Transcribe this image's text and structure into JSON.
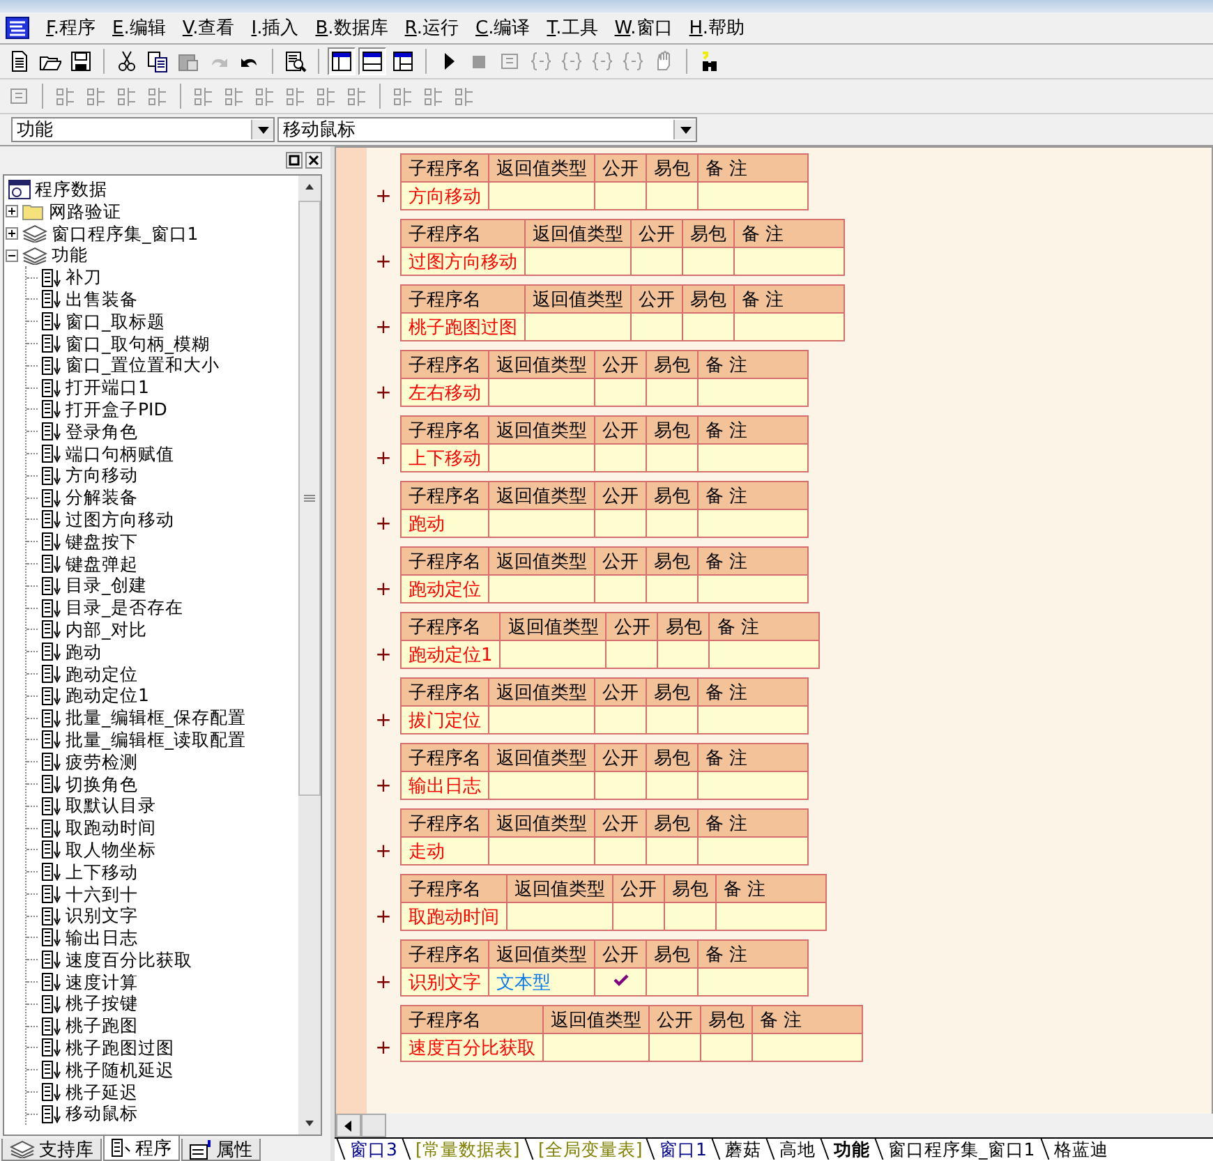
{
  "menu": [
    {
      "key": "F",
      "label": ".程序"
    },
    {
      "key": "E",
      "label": ".编辑"
    },
    {
      "key": "V",
      "label": ".查看"
    },
    {
      "key": "I",
      "label": ".插入"
    },
    {
      "key": "B",
      "label": ".数据库"
    },
    {
      "key": "R",
      "label": ".运行"
    },
    {
      "key": "C",
      "label": ".编译"
    },
    {
      "key": "T",
      "label": ".工具"
    },
    {
      "key": "W",
      "label": ".窗口"
    },
    {
      "key": "H",
      "label": ".帮助"
    }
  ],
  "layout_toggles": [
    {
      "pressed": true
    },
    {
      "pressed": true
    },
    {
      "pressed": false
    }
  ],
  "selectors": [
    {
      "value": "功能"
    },
    {
      "value": "移动鼠标"
    }
  ],
  "tree": {
    "label": "程序数据",
    "children": [
      {
        "label": "网路验证",
        "kind": "folder",
        "expanded": false
      },
      {
        "label": "窗口程序集_窗口1",
        "kind": "module",
        "expanded": false
      },
      {
        "label": "功能",
        "kind": "module",
        "expanded": true,
        "children": [
          {
            "label": "补刀",
            "kind": "sub"
          },
          {
            "label": "出售装备",
            "kind": "sub"
          },
          {
            "label": "窗口_取标题",
            "kind": "sub"
          },
          {
            "label": "窗口_取句柄_模糊",
            "kind": "sub"
          },
          {
            "label": "窗口_置位置和大小",
            "kind": "sub"
          },
          {
            "label": "打开端口1",
            "kind": "sub"
          },
          {
            "label": "打开盒子PID",
            "kind": "sub"
          },
          {
            "label": "登录角色",
            "kind": "sub"
          },
          {
            "label": "端口句柄赋值",
            "kind": "sub"
          },
          {
            "label": "方向移动",
            "kind": "sub"
          },
          {
            "label": "分解装备",
            "kind": "sub"
          },
          {
            "label": "过图方向移动",
            "kind": "sub"
          },
          {
            "label": "键盘按下",
            "kind": "sub"
          },
          {
            "label": "键盘弹起",
            "kind": "sub"
          },
          {
            "label": "目录_创建",
            "kind": "sub"
          },
          {
            "label": "目录_是否存在",
            "kind": "sub"
          },
          {
            "label": "内部_对比",
            "kind": "sub"
          },
          {
            "label": "跑动",
            "kind": "sub"
          },
          {
            "label": "跑动定位",
            "kind": "sub"
          },
          {
            "label": "跑动定位1",
            "kind": "sub"
          },
          {
            "label": "批量_编辑框_保存配置",
            "kind": "sub"
          },
          {
            "label": "批量_编辑框_读取配置",
            "kind": "sub"
          },
          {
            "label": "疲劳检测",
            "kind": "sub"
          },
          {
            "label": "切换角色",
            "kind": "sub"
          },
          {
            "label": "取默认目录",
            "kind": "sub"
          },
          {
            "label": "取跑动时间",
            "kind": "sub"
          },
          {
            "label": "取人物坐标",
            "kind": "sub"
          },
          {
            "label": "上下移动",
            "kind": "sub"
          },
          {
            "label": "十六到十",
            "kind": "sub"
          },
          {
            "label": "识别文字",
            "kind": "sub"
          },
          {
            "label": "输出日志",
            "kind": "sub"
          },
          {
            "label": "速度百分比获取",
            "kind": "sub"
          },
          {
            "label": "速度计算",
            "kind": "sub"
          },
          {
            "label": "桃子按键",
            "kind": "sub"
          },
          {
            "label": "桃子跑图",
            "kind": "sub"
          },
          {
            "label": "桃子跑图过图",
            "kind": "sub"
          },
          {
            "label": "桃子随机延迟",
            "kind": "sub"
          },
          {
            "label": "桃子延迟",
            "kind": "sub"
          },
          {
            "label": "移动鼠标",
            "kind": "sub"
          }
        ]
      }
    ]
  },
  "panel_tabs": [
    {
      "label": "支持库",
      "kind": "library",
      "selected": false
    },
    {
      "label": "程序",
      "kind": "program",
      "selected": true
    },
    {
      "label": "属性",
      "kind": "property",
      "selected": false
    }
  ],
  "subroutines": [
    {
      "expander": "+",
      "columns": [
        "子程序名",
        "返回值类型",
        "公开",
        "易包",
        "备 注"
      ],
      "name": "方向移动",
      "public": false
    },
    {
      "expander": "+",
      "columns": [
        "子程序名",
        "返回值类型",
        "公开",
        "易包",
        "备 注"
      ],
      "name": "过图方向移动",
      "public": false
    },
    {
      "expander": "+",
      "columns": [
        "子程序名",
        "返回值类型",
        "公开",
        "易包",
        "备 注"
      ],
      "name": "桃子跑图过图",
      "public": false
    },
    {
      "expander": "+",
      "columns": [
        "子程序名",
        "返回值类型",
        "公开",
        "易包",
        "备 注"
      ],
      "name": "左右移动",
      "public": false
    },
    {
      "expander": "+",
      "columns": [
        "子程序名",
        "返回值类型",
        "公开",
        "易包",
        "备 注"
      ],
      "name": "上下移动",
      "public": false
    },
    {
      "expander": "+",
      "columns": [
        "子程序名",
        "返回值类型",
        "公开",
        "易包",
        "备 注"
      ],
      "name": "跑动",
      "public": false
    },
    {
      "expander": "+",
      "columns": [
        "子程序名",
        "返回值类型",
        "公开",
        "易包",
        "备 注"
      ],
      "name": "跑动定位",
      "public": false
    },
    {
      "expander": "+",
      "columns": [
        "子程序名",
        "返回值类型",
        "公开",
        "易包",
        "备 注"
      ],
      "name": "跑动定位1",
      "public": false
    },
    {
      "expander": "+",
      "columns": [
        "子程序名",
        "返回值类型",
        "公开",
        "易包",
        "备 注"
      ],
      "name": "拔门定位",
      "public": false
    },
    {
      "expander": "+",
      "columns": [
        "子程序名",
        "返回值类型",
        "公开",
        "易包",
        "备 注"
      ],
      "name": "输出日志",
      "public": false
    },
    {
      "expander": "+",
      "columns": [
        "子程序名",
        "返回值类型",
        "公开",
        "易包",
        "备 注"
      ],
      "name": "走动",
      "public": false
    },
    {
      "expander": "+",
      "columns": [
        "子程序名",
        "返回值类型",
        "公开",
        "易包",
        "备 注"
      ],
      "name": "取跑动时间",
      "public": false
    },
    {
      "expander": "+",
      "columns": [
        "子程序名",
        "返回值类型",
        "公开",
        "易包",
        "备 注"
      ],
      "name": "识别文字",
      "return_type": "文本型",
      "public": true
    },
    {
      "expander": "+",
      "columns": [
        "子程序名",
        "返回值类型",
        "公开",
        "易包",
        "备 注"
      ],
      "name": "速度百分比获取",
      "public": false
    }
  ],
  "doc_tabs": [
    {
      "label": "窗口3",
      "kind": "window",
      "selected": false
    },
    {
      "label": "[常量数据表]",
      "kind": "table",
      "selected": false
    },
    {
      "label": "[全局变量表]",
      "kind": "table",
      "selected": false
    },
    {
      "label": "窗口1",
      "kind": "window",
      "selected": false
    },
    {
      "label": "蘑菇",
      "kind": "module",
      "selected": false
    },
    {
      "label": "高地",
      "kind": "module",
      "selected": false
    },
    {
      "label": "功能",
      "kind": "module",
      "selected": true
    },
    {
      "label": "窗口程序集_窗口1",
      "kind": "module",
      "selected": false
    },
    {
      "label": "格蓝迪",
      "kind": "module",
      "selected": false
    }
  ]
}
